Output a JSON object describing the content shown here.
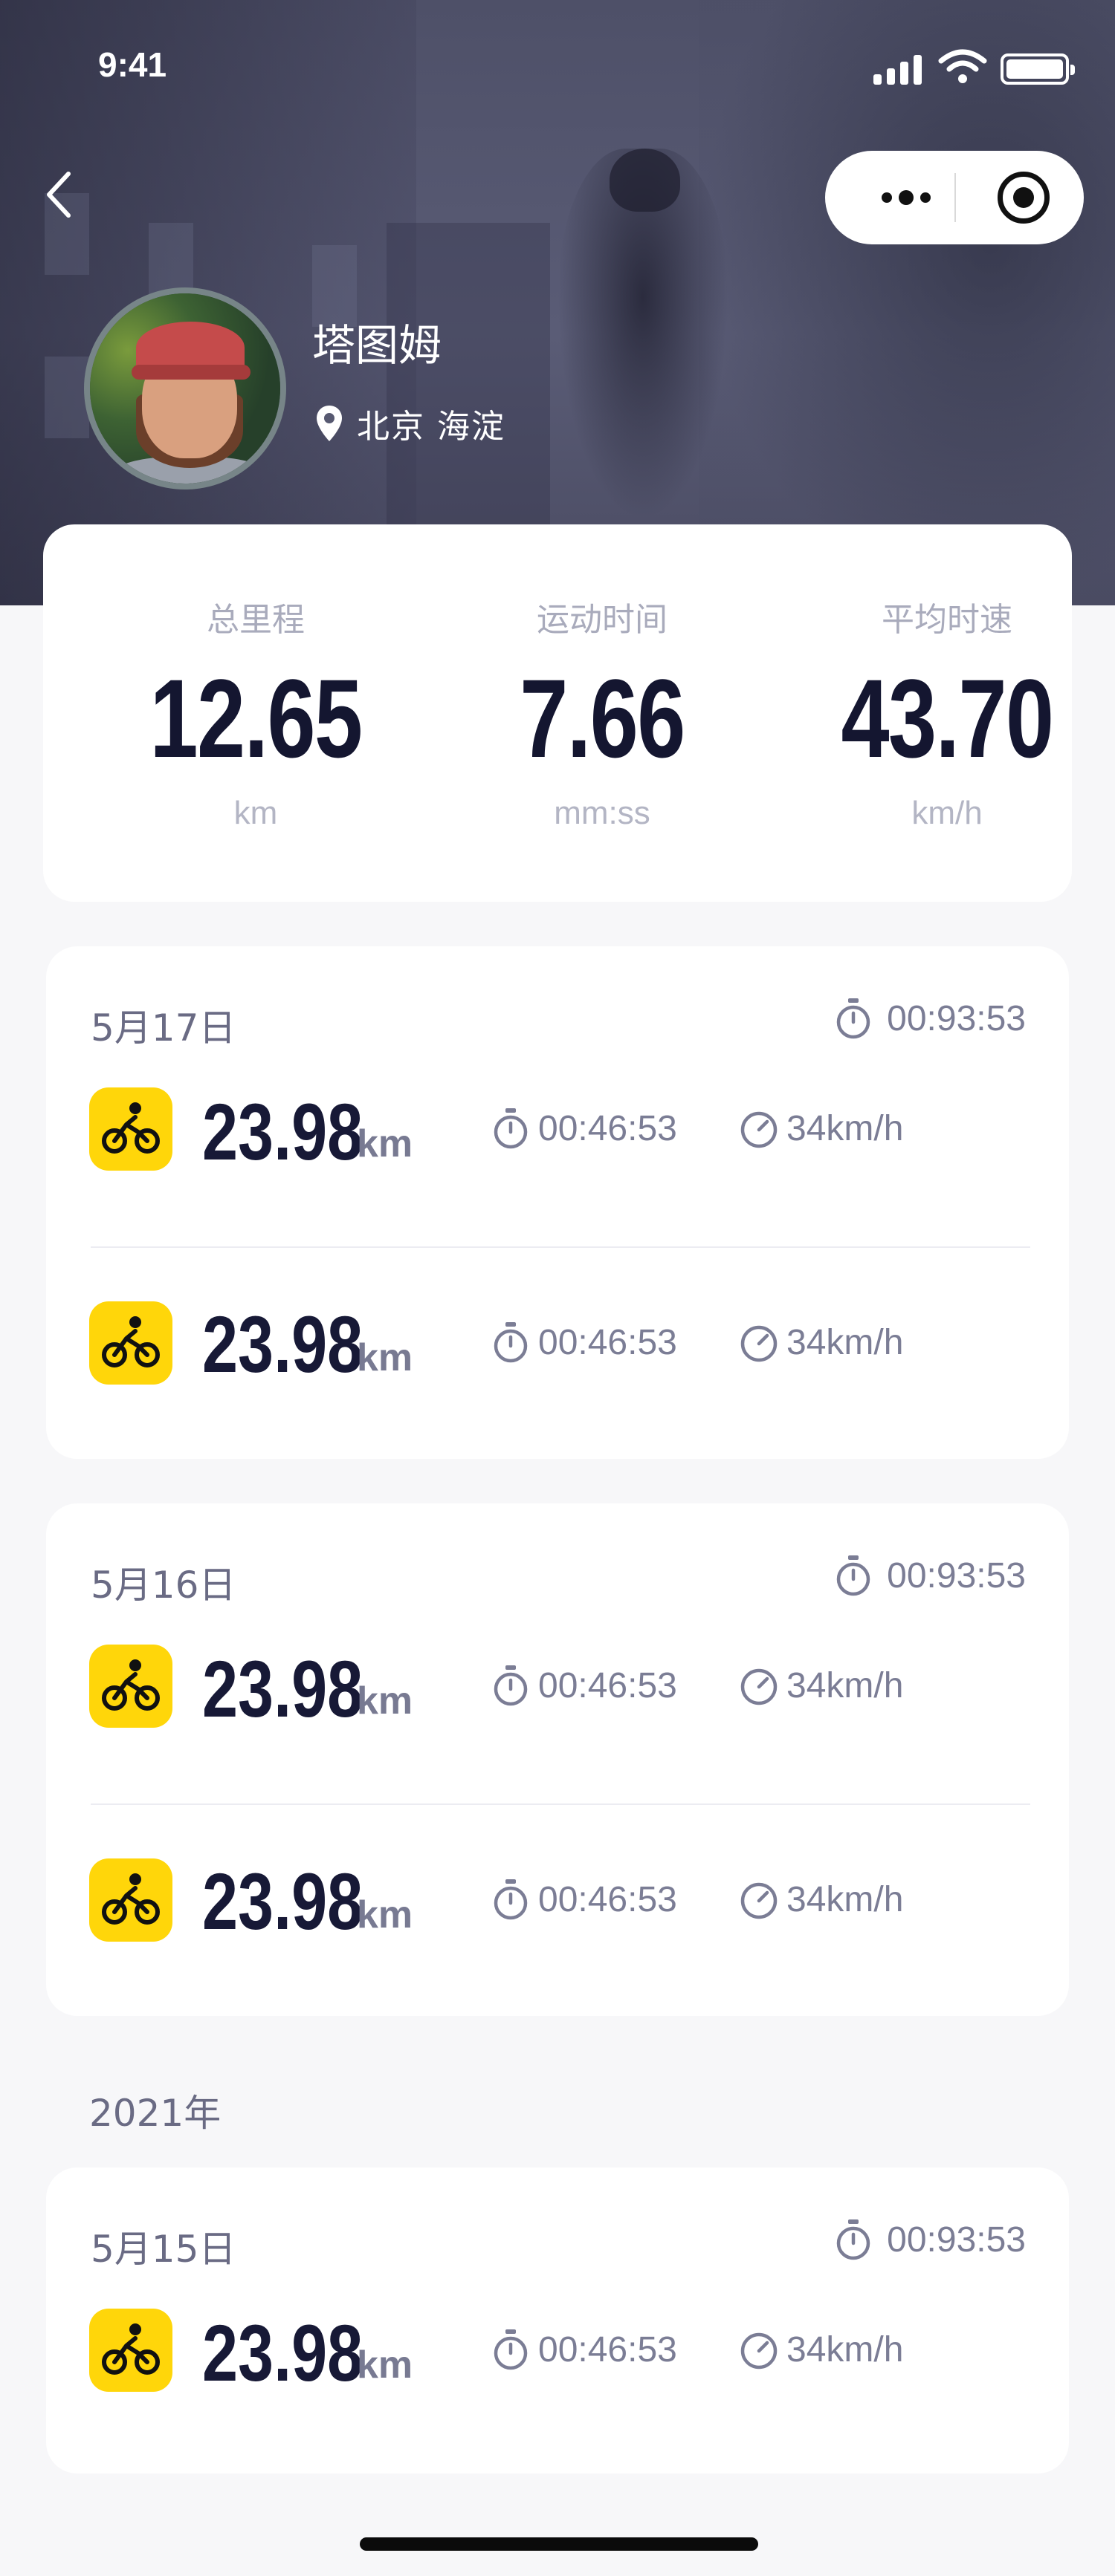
{
  "status_bar": {
    "time": "9:41"
  },
  "profile": {
    "name": "塔图姆",
    "location": "北京 海淀"
  },
  "summary": [
    {
      "label": "总里程",
      "value": "12.65",
      "unit": "km"
    },
    {
      "label": "运动时间",
      "value": "7.66",
      "unit": "mm:ss"
    },
    {
      "label": "平均时速",
      "value": "43.70",
      "unit": "km/h"
    }
  ],
  "days": [
    {
      "date": "5月17日",
      "total_time": "00:93:53",
      "rides": [
        {
          "distance": "23.98",
          "unit": "km",
          "duration": "00:46:53",
          "speed": "34km/h"
        },
        {
          "distance": "23.98",
          "unit": "km",
          "duration": "00:46:53",
          "speed": "34km/h"
        }
      ]
    },
    {
      "date": "5月16日",
      "total_time": "00:93:53",
      "rides": [
        {
          "distance": "23.98",
          "unit": "km",
          "duration": "00:46:53",
          "speed": "34km/h"
        },
        {
          "distance": "23.98",
          "unit": "km",
          "duration": "00:46:53",
          "speed": "34km/h"
        }
      ]
    }
  ],
  "year_label": "2021年",
  "days_2021": [
    {
      "date": "5月15日",
      "total_time": "00:93:53",
      "rides": [
        {
          "distance": "23.98",
          "unit": "km",
          "duration": "00:46:53",
          "speed": "34km/h"
        }
      ]
    }
  ],
  "colors": {
    "accent": "#ffd60a",
    "header": "#4e5068",
    "text_dark": "#141630",
    "text_muted": "#7b7d95"
  },
  "icons": [
    "back-icon",
    "more-icon",
    "close-target-icon",
    "location-pin-icon",
    "stopwatch-icon",
    "speedometer-icon",
    "bicycle-icon"
  ]
}
